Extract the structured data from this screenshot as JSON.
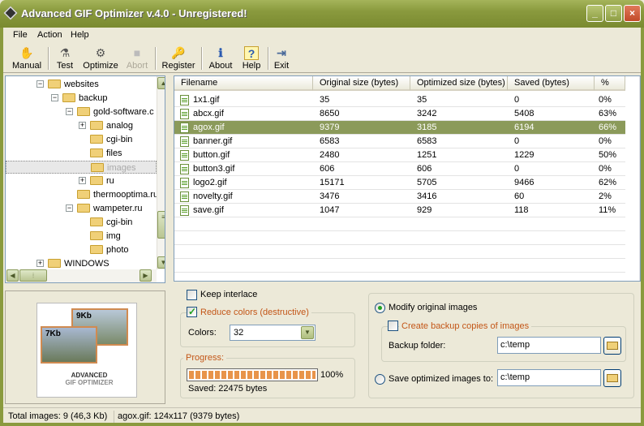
{
  "window": {
    "title": "Advanced GIF Optimizer v.4.0 - Unregistered!",
    "minimize": "_",
    "maximize": "□",
    "close": "×"
  },
  "menu": [
    "File",
    "Action",
    "Help"
  ],
  "toolbar": [
    {
      "label": "Manual",
      "icon": "hand-icon",
      "glyph": "✋"
    },
    {
      "label": "Test",
      "icon": "test-icon",
      "glyph": "⚗"
    },
    {
      "label": "Optimize",
      "icon": "optimize-icon",
      "glyph": "⚙"
    },
    {
      "label": "Abort",
      "icon": "stop-icon",
      "glyph": "■",
      "disabled": true
    },
    {
      "label": "Register",
      "icon": "key-icon",
      "glyph": "🔑"
    },
    {
      "label": "About",
      "icon": "info-icon",
      "glyph": "ℹ"
    },
    {
      "label": "Help",
      "icon": "help-icon",
      "glyph": "?"
    },
    {
      "label": "Exit",
      "icon": "exit-icon",
      "glyph": "⇥"
    }
  ],
  "tree": [
    {
      "label": "websites",
      "level": 0,
      "expander": "−"
    },
    {
      "label": "backup",
      "level": 1,
      "expander": "−"
    },
    {
      "label": "gold-software.c",
      "level": 2,
      "expander": "−"
    },
    {
      "label": "analog",
      "level": 3,
      "expander": "+"
    },
    {
      "label": "cgi-bin",
      "level": 3
    },
    {
      "label": "files",
      "level": 3
    },
    {
      "label": "images",
      "level": 3,
      "selected": true
    },
    {
      "label": "ru",
      "level": 3,
      "expander": "+"
    },
    {
      "label": "thermooptima.ru",
      "level": 2
    },
    {
      "label": "wampeter.ru",
      "level": 2,
      "expander": "−"
    },
    {
      "label": "cgi-bin",
      "level": 3
    },
    {
      "label": "img",
      "level": 3
    },
    {
      "label": "photo",
      "level": 3
    },
    {
      "label": "WINDOWS",
      "level": 0,
      "expander": "+"
    }
  ],
  "preview": {
    "big_size": "9Kb",
    "small_size": "7Kb",
    "logo_line1": "ADVANCED",
    "logo_line2": "GIF OPTIMIZER"
  },
  "columns": [
    "Filename",
    "Original size (bytes)",
    "Optimized size (bytes)",
    "Saved (bytes)",
    "%"
  ],
  "files": [
    {
      "name": "1x1.gif",
      "orig": "35",
      "opt": "35",
      "saved": "0",
      "pct": "0%"
    },
    {
      "name": "abcx.gif",
      "orig": "8650",
      "opt": "3242",
      "saved": "5408",
      "pct": "63%"
    },
    {
      "name": "agox.gif",
      "orig": "9379",
      "opt": "3185",
      "saved": "6194",
      "pct": "66%",
      "selected": true
    },
    {
      "name": "banner.gif",
      "orig": "6583",
      "opt": "6583",
      "saved": "0",
      "pct": "0%"
    },
    {
      "name": "button.gif",
      "orig": "2480",
      "opt": "1251",
      "saved": "1229",
      "pct": "50%"
    },
    {
      "name": "button3.gif",
      "orig": "606",
      "opt": "606",
      "saved": "0",
      "pct": "0%"
    },
    {
      "name": "logo2.gif",
      "orig": "15171",
      "opt": "5705",
      "saved": "9466",
      "pct": "62%"
    },
    {
      "name": "novelty.gif",
      "orig": "3476",
      "opt": "3416",
      "saved": "60",
      "pct": "2%"
    },
    {
      "name": "save.gif",
      "orig": "1047",
      "opt": "929",
      "saved": "118",
      "pct": "11%"
    }
  ],
  "options": {
    "keep_interlace": "Keep interlace",
    "reduce_colors": "Reduce colors (destructive)",
    "colors_label": "Colors:",
    "colors_value": "32",
    "progress_label": "Progress:",
    "progress_fraction": 1.0,
    "progress_text": "100%",
    "saved_text": "Saved: 22475 bytes",
    "modify_original": "Modify original images",
    "create_backup": "Create backup copies of images",
    "backup_folder_label": "Backup folder:",
    "backup_folder_value": "c:\\temp",
    "save_optimized": "Save optimized images to:",
    "save_optimized_value": "c:\\temp"
  },
  "status": {
    "total": "Total images: 9  (46,3 Kb)",
    "current": "agox.gif: 124x117 (9379 bytes)"
  },
  "colors": {
    "title_bar": "#8a9a3e",
    "selection": "#8b9a5a",
    "group_label": "#c35617",
    "check": "#21a121"
  }
}
